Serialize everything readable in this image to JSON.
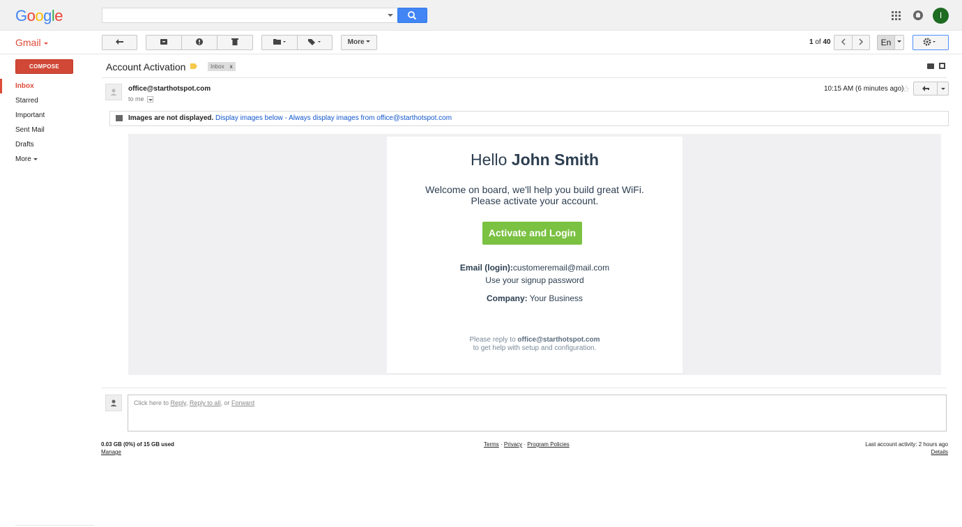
{
  "header": {
    "logo": [
      "G",
      "o",
      "o",
      "g",
      "l",
      "e"
    ],
    "logo_colors": [
      "#4285f4",
      "#ea4335",
      "#fbbc05",
      "#4285f4",
      "#34a853",
      "#ea4335"
    ],
    "search": {
      "value": "",
      "placeholder": ""
    },
    "avatar_letter": "I"
  },
  "toolbar": {
    "app_label": "Gmail",
    "more_label": "More",
    "pager": {
      "current": "1",
      "of": "of",
      "total": "40"
    },
    "language": "En"
  },
  "sidebar": {
    "compose_label": "COMPOSE",
    "items": [
      {
        "label": "Inbox",
        "active": true
      },
      {
        "label": "Starred"
      },
      {
        "label": "Important"
      },
      {
        "label": "Sent Mail"
      },
      {
        "label": "Drafts"
      },
      {
        "label": "More"
      }
    ]
  },
  "message": {
    "subject": "Account Activation",
    "label_chip": "Inbox",
    "label_chip_close": "x",
    "sender": "office@starthotspot.com",
    "to": "to me",
    "timestamp": "10:15 AM (6 minutes ago)",
    "images_notice": {
      "bold": "Images are not displayed.",
      "link1": "Display images below",
      "sep": " - ",
      "link2": "Always display images from office@starthotspot.com"
    }
  },
  "email": {
    "hello_prefix": "Hello",
    "name": "John Smith",
    "welcome_line1": "Welcome on board, we'll help you build great WiFi.",
    "welcome_line2": "Please activate your account.",
    "button_label": "Activate and Login",
    "email_label": "Email (login):",
    "email_value": "customeremail@mail.com",
    "password_note": "Use your signup password",
    "company_label": "Company:",
    "company_value": "Your Business",
    "help_prefix": "Please reply to",
    "help_email": "office@starthotspot.com",
    "help_suffix": "to get help with setup and configuration."
  },
  "reply": {
    "prefix": "Click here to",
    "reply": "Reply",
    "reply_all": "Reply to all",
    "or": ", or",
    "forward": "Forward"
  },
  "footer": {
    "storage": "0.03 GB (0%) of 15 GB used",
    "manage": "Manage",
    "terms": "Terms",
    "privacy": "Privacy",
    "program_policies": "Program Policies",
    "dot": "·",
    "last_activity": "Last account activity: 2 hours ago",
    "details": "Details"
  },
  "colors": {
    "gmail_red": "#dd4b39",
    "compose": "#d14836",
    "search_blue": "#4285f4",
    "activate_green": "#7bc142",
    "link_blue": "#1155cc"
  }
}
